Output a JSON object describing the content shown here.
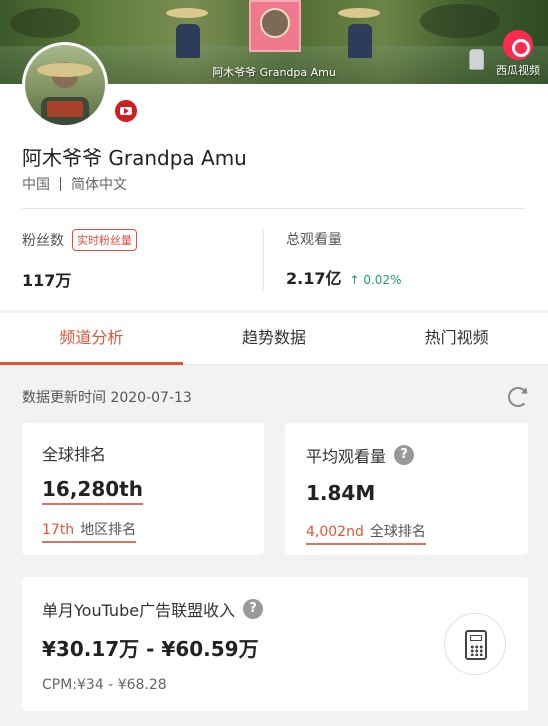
{
  "banner": {
    "caption": "阿木爷爷 Grandpa Amu",
    "platform_label": "西瓜视频",
    "platform_icon": "xigua-logo-icon"
  },
  "profile": {
    "channel_name": "阿木爷爷 Grandpa Amu",
    "country": "中国",
    "language": "简体中文",
    "platform_badge_icon": "youtube-icon"
  },
  "stats": {
    "subscribers_label": "粉丝数",
    "realtime_tag": "实时粉丝量",
    "subscribers_value": "117万",
    "views_label": "总观看量",
    "views_value": "2.17亿",
    "views_trend": "↑ 0.02%"
  },
  "tabs": [
    {
      "label": "频道分析",
      "active": true
    },
    {
      "label": "趋势数据",
      "active": false
    },
    {
      "label": "热门视频",
      "active": false
    }
  ],
  "update": {
    "text": "数据更新时间 2020-07-13",
    "refresh_icon": "refresh-icon"
  },
  "cards": {
    "global_rank": {
      "title": "全球排名",
      "value": "16,280th",
      "sub_value": "17th",
      "sub_label": "地区排名"
    },
    "avg_views": {
      "title": "平均观看量",
      "help": "?",
      "value": "1.84M",
      "sub_value": "4,002nd",
      "sub_label": "全球排名"
    },
    "revenue": {
      "title": "单月YouTube广告联盟收入",
      "help": "?",
      "value": "¥30.17万 - ¥60.59万",
      "cpm": "CPM:¥34 - ¥68.28",
      "calculator_icon": "calculator-icon"
    }
  },
  "colors": {
    "accent": "#e05538",
    "trend_up": "#1aa260",
    "youtube": "#cc1f1f",
    "xigua": "#ff2a4f"
  }
}
